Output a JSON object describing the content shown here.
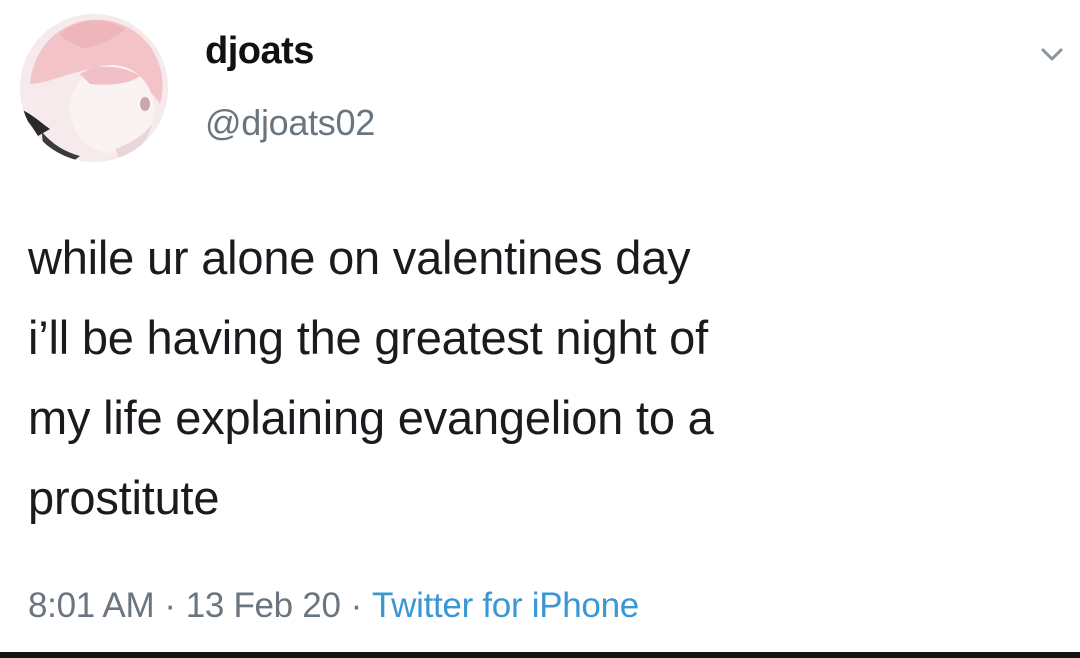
{
  "tweet": {
    "author": {
      "display_name": "djoats",
      "handle": "@djoats02",
      "avatar_icon": "anime-avatar-icon"
    },
    "menu_icon": "chevron-down-icon",
    "text": "while ur alone on valentines day\ni’ll be having the greatest night of\nmy life explaining evangelion to a\nprostitute",
    "time": "8:01 AM",
    "separator": "·",
    "date": "13 Feb 20",
    "source": "Twitter for iPhone"
  },
  "colors": {
    "text": "#1a1b1e",
    "muted": "#6a7580",
    "link": "#3a97d4",
    "background": "#ffffff"
  }
}
